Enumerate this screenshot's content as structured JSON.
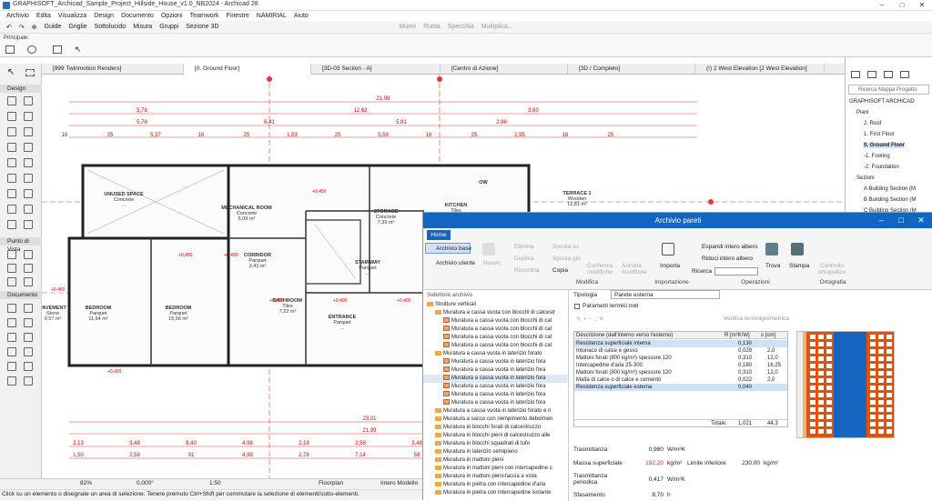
{
  "window": {
    "title": "GRAPHISOFT_Archicad_Sample_Project_Hillside_House_v1.0_NB2024 - Archicad 28"
  },
  "menu": [
    "Archivio",
    "Edita",
    "Visualizza",
    "Design",
    "Documento",
    "Opzioni",
    "Teamwork",
    "Finestre",
    "NAMIRIAL",
    "Aiuto"
  ],
  "toolbar": {
    "guide": "Guide",
    "griglie": "Griglie",
    "sottolucido": "Sottolucido",
    "misura": "Misura",
    "gruppi": "Gruppi",
    "sezione3d": "Sezione 3D",
    "muovi": "Muovi",
    "ruota": "Ruota",
    "specchia": "Specchia",
    "multiplica": "Multiplica..."
  },
  "infobar": {
    "label": "Principale:"
  },
  "toolbox": {
    "design": "Design",
    "punto_di_vista": "Punto di Vista",
    "documento": "Documento"
  },
  "tabs": [
    "[999 Twinmotion Renders]",
    "[0. Ground Floor]",
    "[3D-03 Section - A]",
    "[Centro di Azione]",
    "[3D / Completo]",
    "(!) 2 West Elevation [2 West Elevation]"
  ],
  "plan": {
    "dims_top": [
      "21,99",
      "5,78",
      "12,62",
      "3,60",
      "5,78",
      "6,41",
      "5,81",
      "2,96"
    ],
    "dims_small": [
      "16",
      "25",
      "5,37",
      "16",
      "25",
      "1,03",
      "25",
      "5,59",
      "16",
      "25",
      "2,95",
      "16",
      "25"
    ],
    "dims_bottom": [
      "23,01",
      "21,99",
      "2,13",
      "3,48",
      "8,40",
      "4,98",
      "2,18",
      "2,58",
      "3,48",
      "1,50",
      "2,58",
      "91",
      "4,98",
      "2,78",
      "7,14",
      "58"
    ],
    "rooms": [
      {
        "name": "UNUSED SPACE",
        "sub": "Concrete",
        "area": "..."
      },
      {
        "name": "MECHANICAL ROOM",
        "sub": "Concrete",
        "area": "5,09 m²"
      },
      {
        "name": "STORAGE",
        "sub": "Concrete",
        "area": "7,39 m²"
      },
      {
        "name": "KITCHEN",
        "sub": "Tiles",
        "area": "..."
      },
      {
        "name": "TERRACE 1",
        "sub": "Wooden",
        "area": "12,81 m²"
      },
      {
        "name": "CORRIDOR",
        "sub": "Parquet",
        "area": "2,41 m²"
      },
      {
        "name": "STAIRWAY",
        "sub": "Parquet",
        "area": "..."
      },
      {
        "name": "BATHROOM",
        "sub": "Tiles",
        "area": "7,22 m²"
      },
      {
        "name": "BEDROOM",
        "sub": "Parquet",
        "area": "11,64 m²"
      },
      {
        "name": "BEDROOM",
        "sub": "Parquet",
        "area": "15,56 m²"
      },
      {
        "name": "ENTRANCE",
        "sub": "Parquet",
        "area": "..."
      },
      {
        "name": "PAVEMENT",
        "sub": "Stone",
        "area": "9,57 m²"
      },
      {
        "name": "OW",
        "sub": "",
        "area": ""
      }
    ],
    "elev": [
      "+0,450",
      "+0,400",
      "+0,400",
      "+0,400",
      "+0,400",
      "+0,400",
      "+0,420",
      "+0,450",
      "+0,400"
    ]
  },
  "statusbar": {
    "zoom": "82%",
    "angle": "0,000°",
    "scale": "1:50",
    "view": "Floorplan",
    "model": "Intero Modello",
    "hint": "Click su un elemento o disegnate un area di selezione. Tenere premuto Ctrl+Shift per commutare la selezione di elementi/sotto-elementi."
  },
  "navigator": {
    "search": "Ricerca Mappa Progetto",
    "items": [
      {
        "label": "GRAPHISOFT ARCHICAD",
        "indent": 0,
        "sel": false
      },
      {
        "label": "Piani",
        "indent": 1,
        "sel": false
      },
      {
        "label": "2. Roof",
        "indent": 2,
        "sel": false
      },
      {
        "label": "1. First Floor",
        "indent": 2,
        "sel": false
      },
      {
        "label": "0. Ground Floor",
        "indent": 2,
        "sel": true
      },
      {
        "label": "-1. Footing",
        "indent": 2,
        "sel": false
      },
      {
        "label": "-2. Foundation",
        "indent": 2,
        "sel": false
      },
      {
        "label": "Sezioni",
        "indent": 1,
        "sel": false
      },
      {
        "label": "A Building Section (M",
        "indent": 2,
        "sel": false
      },
      {
        "label": "B Building Section (M",
        "indent": 2,
        "sel": false
      },
      {
        "label": "C Building Section (M",
        "indent": 2,
        "sel": false
      },
      {
        "label": "D Building Section (M",
        "indent": 2,
        "sel": false
      }
    ]
  },
  "dialog": {
    "title": "Archivio pareti",
    "home_tab": "Home",
    "ribbon": {
      "archivio_base": "Archivio base",
      "archivio_utente": "Archivio utente",
      "nuovo": "Nuovo",
      "elimina": "Elimina",
      "duplica": "Duplica",
      "rinomina": "Rinomina",
      "sposta_su": "Sposta su",
      "sposta_giu": "Sposta giù",
      "copia": "Copia",
      "conferma": "Conferma modifiche",
      "annulla": "Annulla modifiche",
      "importa": "Importa",
      "espandi": "Espandi intero albero",
      "riduci": "Riduci intero albero",
      "ricerca": "Ricerca",
      "trova": "Trova",
      "stampa": "Stampa",
      "controllo": "Controllo ortografico",
      "group_modifica": "Modifica",
      "group_importazione": "Importazione",
      "group_operazioni": "Operazioni",
      "group_ortografia": "Ortografia"
    },
    "selector": {
      "title": "Selettore archivio",
      "rows": [
        {
          "text": "Strutture verticali",
          "indent": 0,
          "type": "folder",
          "hl": false
        },
        {
          "text": "Muratura a cassa vuota con blocchi di calcestr",
          "indent": 1,
          "type": "folder",
          "hl": false
        },
        {
          "text": "Muratura a cassa vuota con blocchi di cal",
          "indent": 2,
          "type": "wall",
          "hl": false
        },
        {
          "text": "Muratura a cassa vuota con blocchi di cal",
          "indent": 2,
          "type": "wall",
          "hl": false
        },
        {
          "text": "Muratura a cassa vuota con blocchi di cal",
          "indent": 2,
          "type": "wall",
          "hl": false
        },
        {
          "text": "Muratura a cassa vuota con blocchi di cal",
          "indent": 2,
          "type": "wall",
          "hl": false
        },
        {
          "text": "Muratura a cassa vuota in laterizio forato",
          "indent": 1,
          "type": "folder",
          "hl": false
        },
        {
          "text": "Muratura a cassa vuota in laterizio fora",
          "indent": 2,
          "type": "wall",
          "hl": false
        },
        {
          "text": "Muratura a cassa vuota in laterizio fora",
          "indent": 2,
          "type": "wall",
          "hl": false
        },
        {
          "text": "Muratura a cassa vuota in laterizio fora",
          "indent": 2,
          "type": "wall",
          "hl": true
        },
        {
          "text": "Muratura a cassa vuota in laterizio fora",
          "indent": 2,
          "type": "wall",
          "hl": false
        },
        {
          "text": "Muratura a cassa vuota in laterizio fora",
          "indent": 2,
          "type": "wall",
          "hl": false
        },
        {
          "text": "Muratura a cassa vuota in laterizio fora",
          "indent": 2,
          "type": "wall",
          "hl": false
        },
        {
          "text": "Muratura a cassa vuota in laterizio forato e n",
          "indent": 1,
          "type": "folder",
          "hl": false
        },
        {
          "text": "Muratura a sacco con riempimento debolmen",
          "indent": 1,
          "type": "folder",
          "hl": false
        },
        {
          "text": "Muratura in blocchi forati di calcestruzzo",
          "indent": 1,
          "type": "folder",
          "hl": false
        },
        {
          "text": "Muratura in blocchi pieni di calcestruzzo alle",
          "indent": 1,
          "type": "folder",
          "hl": false
        },
        {
          "text": "Muratura in blocchi squadrati di tufo",
          "indent": 1,
          "type": "folder",
          "hl": false
        },
        {
          "text": "Muratura in laterizio semipieno",
          "indent": 1,
          "type": "folder",
          "hl": false
        },
        {
          "text": "Muratura in mattoni pieni",
          "indent": 1,
          "type": "folder",
          "hl": false
        },
        {
          "text": "Muratura in mattoni pieni con intercapedine c",
          "indent": 1,
          "type": "folder",
          "hl": false
        },
        {
          "text": "Muratura in mattoni pieni-faccia a vista",
          "indent": 1,
          "type": "folder",
          "hl": false
        },
        {
          "text": "Muratura in pietra con intercapedine d'aria",
          "indent": 1,
          "type": "folder",
          "hl": false
        },
        {
          "text": "Muratura in pietra con intercapedine isolante",
          "indent": 1,
          "type": "folder",
          "hl": false
        }
      ]
    },
    "props": {
      "tipologia_label": "Tipologia",
      "tipologia_value": "Parete esterna",
      "parametri": "Parametri termici noti",
      "verifica": "Verifica termoigrometrica",
      "table_headers": [
        "Descrizione (dall'interno verso l'esterno)",
        "R [m²K/W]",
        "s [cm]"
      ],
      "layers": [
        {
          "desc": "Resistenza superficiale interna",
          "r": "0,130",
          "s": "",
          "sel": true
        },
        {
          "desc": "Intonaco di calce e gesso",
          "r": "0,029",
          "s": "2,0",
          "sel": false
        },
        {
          "desc": "Mattoni forati (800 kg/m³) spessore 120",
          "r": "0,310",
          "s": "12,0",
          "sel": false
        },
        {
          "desc": "Intercapedine d'aria 25-300",
          "r": "0,180",
          "s": "16,25",
          "sel": false
        },
        {
          "desc": "Mattoni forati (800 kg/m³) spessore 120",
          "r": "0,310",
          "s": "12,0",
          "sel": false
        },
        {
          "desc": "Malta di calce o di calce e cemento",
          "r": "0,022",
          "s": "2,0",
          "sel": false
        },
        {
          "desc": "Resistenza superficiale esterna",
          "r": "0,040",
          "s": "",
          "sel": true
        }
      ],
      "totale_label": "Totale:",
      "totale_r": "1,021",
      "totale_s": "44,3",
      "trasmittanza_label": "Trasmittanza",
      "trasmittanza_value": "0,980",
      "trasmittanza_unit": "W/m²K",
      "massa_label": "Massa superficiale",
      "massa_value": "192,20",
      "massa_unit": "kg/m²",
      "limite_label": "Limite inferiore",
      "limite_value": "230,00",
      "limite_unit": "kg/m²",
      "trasm_periodica_label": "Trasmittanza periodica",
      "trasm_periodica_value": "0,417",
      "trasm_periodica_unit": "W/m²K",
      "sfasamento_label": "Sfasamento",
      "sfasamento_value": "8,70",
      "sfasamento_unit": "h"
    }
  }
}
